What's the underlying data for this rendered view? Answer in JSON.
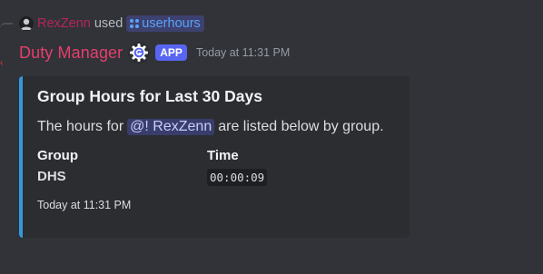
{
  "interaction": {
    "user": "RexZenn",
    "verb": "used",
    "command": "userhours"
  },
  "message": {
    "author": "Duty Manager",
    "app_tag": "APP",
    "timestamp": "Today at 11:31 PM"
  },
  "embed": {
    "accent_color": "#3498db",
    "title": "Group Hours for Last 30 Days",
    "desc_prefix": "The hours for",
    "mention": "@! RexZenn",
    "desc_suffix": "are listed below by group.",
    "fields": {
      "group_header": "Group",
      "time_header": "Time",
      "group_value": "DHS",
      "time_value": "00:00:09"
    },
    "footer": "Today at 11:31 PM"
  },
  "colors": {
    "author_color": "#e63e6d",
    "username_color": "#b7245b",
    "app_tag_bg": "#5865f2"
  }
}
